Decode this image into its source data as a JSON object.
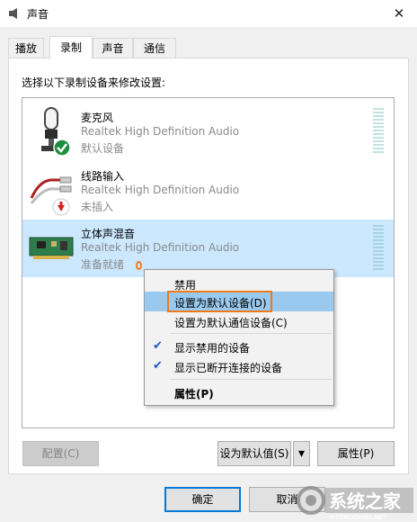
{
  "window": {
    "title": "声音",
    "close_symbol": "✕"
  },
  "tabs": [
    {
      "label": "播放",
      "active": false
    },
    {
      "label": "录制",
      "active": true
    },
    {
      "label": "声音",
      "active": false
    },
    {
      "label": "通信",
      "active": false
    }
  ],
  "instruction": "选择以下录制设备来修改设置:",
  "devices": [
    {
      "name": "麦克风",
      "driver": "Realtek High Definition Audio",
      "status": "默认设备",
      "icon": "microphone-icon",
      "badge": "green-check-badge",
      "selected": false
    },
    {
      "name": "线路输入",
      "driver": "Realtek High Definition Audio",
      "status": "未插入",
      "icon": "line-in-jack-icon",
      "badge": "red-down-arrow-badge",
      "selected": false
    },
    {
      "name": "立体声混音",
      "driver": "Realtek High Definition Audio",
      "status": "准备就绪",
      "icon": "sound-card-icon",
      "badge": "",
      "selected": true
    }
  ],
  "context_menu": {
    "items": [
      {
        "label": "禁用",
        "checked": false,
        "bold": false,
        "highlighted": false
      },
      {
        "label": "设置为默认设备(D)",
        "checked": false,
        "bold": false,
        "highlighted": true
      },
      {
        "label": "设置为默认通信设备(C)",
        "checked": false,
        "bold": false,
        "highlighted": false
      },
      {
        "label": "显示禁用的设备",
        "checked": true,
        "bold": false,
        "highlighted": false
      },
      {
        "label": "显示已断开连接的设备",
        "checked": true,
        "bold": false,
        "highlighted": false
      },
      {
        "label": "属性(P)",
        "checked": false,
        "bold": true,
        "highlighted": false
      }
    ],
    "check_symbol": "✔"
  },
  "buttons": {
    "configure": "配置(C)",
    "set_default": "设为默认值(S)",
    "properties": "属性(P)",
    "ok": "确定",
    "cancel": "取消",
    "dropdown_symbol": "▾"
  },
  "watermark": {
    "text": "系统之家",
    "sub": "XITONGZHIJIA.NET"
  },
  "colors": {
    "selection": "#cce8ff",
    "menu_highlight": "#99c9ef",
    "accent_orange": "#f07a1a",
    "default_button_border": "#0078d7"
  }
}
